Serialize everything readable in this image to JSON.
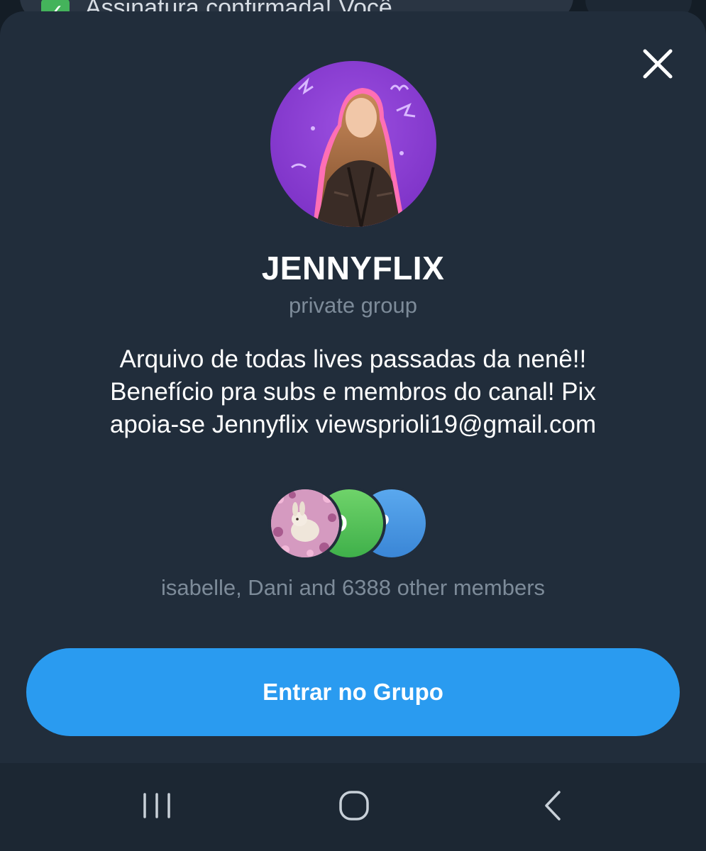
{
  "notification": {
    "check_icon": "check-mark-icon",
    "text": "Assinatura confirmada! Você"
  },
  "sheet": {
    "close_icon": "close-icon",
    "group_name": "JENNYFLIX",
    "group_type": "private group",
    "description_lines": [
      "Arquivo de todas lives passadas da nenê!!",
      "Benefício pra subs e membros do canal! Pix",
      "apoia-se Jennyflix viewsprioli19@gmail.com"
    ],
    "members": {
      "avatars": [
        {
          "name": "isabelle",
          "initial": ""
        },
        {
          "name": "Dani",
          "initial": "D"
        },
        {
          "name": "P",
          "initial": "P"
        }
      ],
      "caption": "isabelle, Dani and 6388 other members"
    },
    "join_button_label": "Entrar no Grupo"
  },
  "nav_bar": {
    "recents_icon": "recent-apps-icon",
    "home_icon": "home-icon",
    "back_icon": "back-icon"
  },
  "colors": {
    "sheet_bg": "#212d3b",
    "accent": "#2a9bf0",
    "secondary_text": "#7d8b99",
    "avatar_purple": "#8b3fd0"
  }
}
